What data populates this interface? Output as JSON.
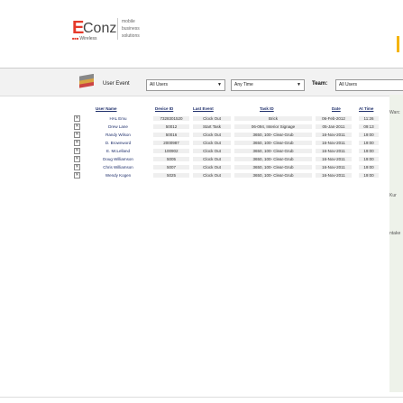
{
  "brand": {
    "e": "E",
    "conz": "Conz",
    "wireless": "Wireless",
    "tagline": [
      "mobile",
      "business",
      "solutions"
    ]
  },
  "toolbar": {
    "title": "User Event",
    "user_select": "All Users",
    "time_select": "Any Time",
    "team_label": "Team:",
    "team_select": "All Users"
  },
  "table": {
    "headers": [
      "User Name",
      "Device ID",
      "Last Event",
      "Task ID",
      "Date",
      "At Time"
    ],
    "rows": [
      [
        "HAL Emu",
        "7328301520",
        "Clock Out",
        "Brick",
        "06-Feb-2012",
        "11:26"
      ],
      [
        "Drew Lane",
        "50012",
        "Start Task",
        "06-094, Interior Signage",
        "05-Jan-2011",
        "09:13"
      ],
      [
        "Randy Wilson",
        "50016",
        "Clock Out",
        "3650, 100- Clear-Grub",
        "16-Nov-2011",
        "19:00"
      ],
      [
        "D. Brownword",
        "2000987",
        "Clock Out",
        "3650, 100- Clear-Grub",
        "16-Nov-2011",
        "19:00"
      ],
      [
        "E. McLelland",
        "100902",
        "Clock Out",
        "3650, 100- Clear-Grub",
        "16-Nov-2011",
        "19:00"
      ],
      [
        "Doug Williamson",
        "5005",
        "Clock Out",
        "3650, 100- Clear-Grub",
        "16-Nov-2011",
        "19:00"
      ],
      [
        "Chris Williamson",
        "5007",
        "Clock Out",
        "3650, 100- Clear-Grub",
        "16-Nov-2011",
        "19:00"
      ],
      [
        "Wendy Kogen",
        "5025",
        "Clock Out",
        "3650, 100- Clear-Grub",
        "16-Nov-2011",
        "19:00"
      ]
    ]
  },
  "right_labels": [
    "Warc",
    "Kur",
    "ntake"
  ]
}
